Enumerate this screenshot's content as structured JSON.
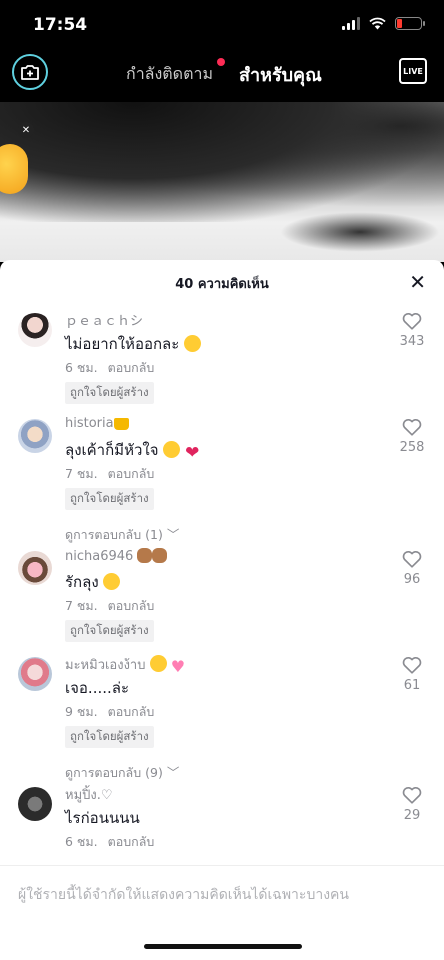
{
  "status_bar": {
    "time": "17:54"
  },
  "nav": {
    "following": "กำลังติดตาม",
    "for_you": "สำหรับคุณ",
    "live": "LIVE"
  },
  "sheet": {
    "title": "40 ความคิดเห็น",
    "close": "✕"
  },
  "comments": [
    {
      "user": "ｐｅａｃｈシ",
      "text": "ไม่อยากให้ออกละ",
      "time": "6 ชม.",
      "reply": "ตอบกลับ",
      "badge": "ถูกใจโดยผู้สร้าง",
      "likes": "343"
    },
    {
      "user": "historia",
      "text": "ลุงเค้าก็มีหัวใจ",
      "time": "7 ชม.",
      "reply": "ตอบกลับ",
      "badge": "ถูกใจโดยผู้สร้าง",
      "likes": "258",
      "view_replies": "ดูการตอบกลับ (1)"
    },
    {
      "user": "nicha6946",
      "text": "รักลุง",
      "time": "7 ชม.",
      "reply": "ตอบกลับ",
      "badge": "ถูกใจโดยผู้สร้าง",
      "likes": "96"
    },
    {
      "user": "มะหมิวเองง้าบ",
      "text": "เจอ.....ล่ะ",
      "time": "9 ชม.",
      "reply": "ตอบกลับ",
      "badge": "ถูกใจโดยผู้สร้าง",
      "likes": "61",
      "view_replies": "ดูการตอบกลับ (9)"
    },
    {
      "user": "หมูปิ้ง.♡",
      "text": "ไรก่อนนนน",
      "time": "6 ชม.",
      "reply": "ตอบกลับ",
      "likes": "29"
    }
  ],
  "restricted_notice": "ผู้ใช้รายนี้ได้จำกัดให้แสดงความคิดเห็นได้เฉพาะบางคน"
}
